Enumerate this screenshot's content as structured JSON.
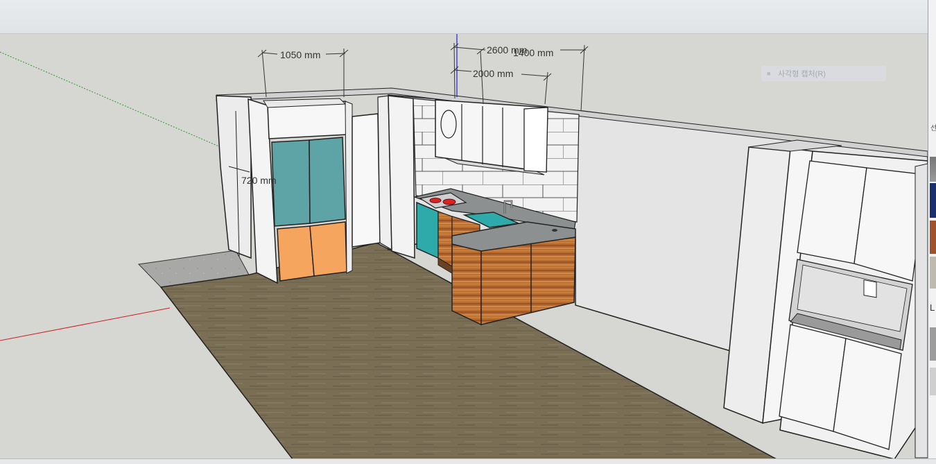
{
  "colors": {
    "background": "#d6d6d2",
    "floor": "#7a6f55",
    "wall": "#e6e6e6",
    "fridge_top": "#5ea3a6",
    "fridge_bottom": "#f6a55e",
    "wood": "#b86a2e",
    "countertop": "#8d9090",
    "axis_red": "#cc2222",
    "axis_green": "#2a9a2a",
    "axis_blue": "#2222cc"
  },
  "dimensions": {
    "fridge_width": "1050 mm",
    "total_width": "2600 mm",
    "upper_cabinet_width": "1400 mm",
    "counter_width": "2000 mm",
    "fridge_depth": "720 mm"
  },
  "tooltip": {
    "icon": "rectangle-select-icon",
    "label": "사각형 캡처(R)"
  },
  "right_panel": {
    "partial_label": "L",
    "partial_top_label": "선"
  }
}
